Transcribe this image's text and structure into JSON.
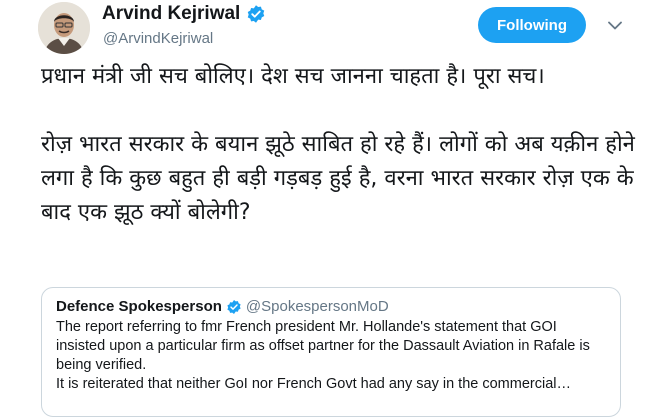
{
  "author": {
    "name": "Arvind Kejriwal",
    "handle": "@ArvindKejriwal"
  },
  "follow_button": {
    "label": "Following"
  },
  "tweet": {
    "text": "प्रधान मंत्री जी सच बोलिए। देश सच जानना चाहता है। पूरा सच।\n\nरोज़ भारत सरकार के बयान झूठे साबित हो रहे हैं। लोगों को अब यक़ीन होने लगा है कि कुछ बहुत ही बड़ी गड़बड़ हुई है, वरना भारत सरकार रोज़ एक के बाद एक झूठ क्यों बोलेगी?"
  },
  "quote": {
    "name": "Defence Spokesperson",
    "handle": "@SpokespersonMoD",
    "paragraph1": "The report referring to  fmr French president Mr. Hollande's statement that GOI insisted upon a particular firm as offset partner for the Dassault Aviation in Rafale is being verified.",
    "paragraph2": "It is reiterated that neither GoI nor French Govt had any say in the commercial…"
  },
  "colors": {
    "accent": "#1da1f2",
    "text": "#14171a",
    "secondary_text": "#657786",
    "border": "#ccd6dd"
  },
  "icons": {
    "verified": "verified-badge-icon",
    "caret": "chevron-down-icon",
    "avatar": "profile-photo"
  }
}
